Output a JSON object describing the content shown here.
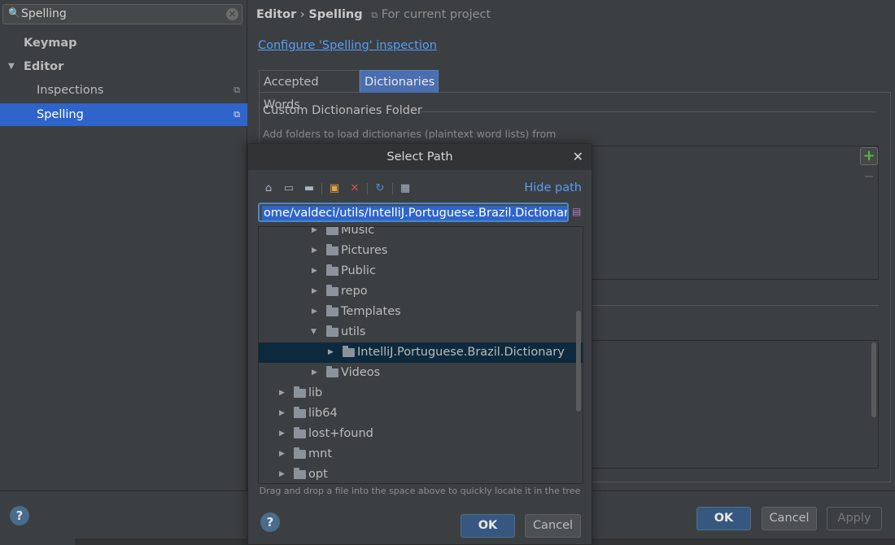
{
  "sidebar": {
    "search_value": "Spelling",
    "items": [
      {
        "label": "Keymap"
      },
      {
        "label": "Editor"
      },
      {
        "label": "Inspections"
      },
      {
        "label": "Spelling"
      }
    ]
  },
  "header": {
    "crumb_parent": "Editor",
    "crumb_sep": "›",
    "crumb_current": "Spelling",
    "scope_icon": "copy-icon",
    "scope_label": "For current project"
  },
  "main": {
    "configure_link": "Configure 'Spelling' inspection",
    "tabs": [
      {
        "label": "Accepted Words"
      },
      {
        "label": "Dictionaries"
      }
    ],
    "section_title": "Custom Dictionaries Folder",
    "section_desc": "Add folders to load dictionaries (plaintext word lists) from",
    "add_label": "+",
    "remove_label": "−"
  },
  "footer": {
    "help": "?",
    "ok": "OK",
    "cancel": "Cancel",
    "apply": "Apply"
  },
  "dialog": {
    "title": "Select Path",
    "close": "✕",
    "hide_path": "Hide path",
    "path_value": "ome/valdeci/utils/IntelliJ.Portuguese.Brazil.Dictionary",
    "tree_rows": [
      {
        "label": "Music"
      },
      {
        "label": "Pictures"
      },
      {
        "label": "Public"
      },
      {
        "label": "repo"
      },
      {
        "label": "Templates"
      },
      {
        "label": "utils"
      },
      {
        "label": "IntelliJ.Portuguese.Brazil.Dictionary"
      },
      {
        "label": "Videos"
      },
      {
        "label": "lib"
      },
      {
        "label": "lib64"
      },
      {
        "label": "lost+found"
      },
      {
        "label": "mnt"
      },
      {
        "label": "opt"
      }
    ],
    "hint": "Drag and drop a file into the space above to quickly locate it in the tree",
    "help": "?",
    "ok": "OK",
    "cancel": "Cancel"
  },
  "colors": {
    "accent": "#2f65ca",
    "link": "#589df6",
    "default_button": "#365880"
  }
}
